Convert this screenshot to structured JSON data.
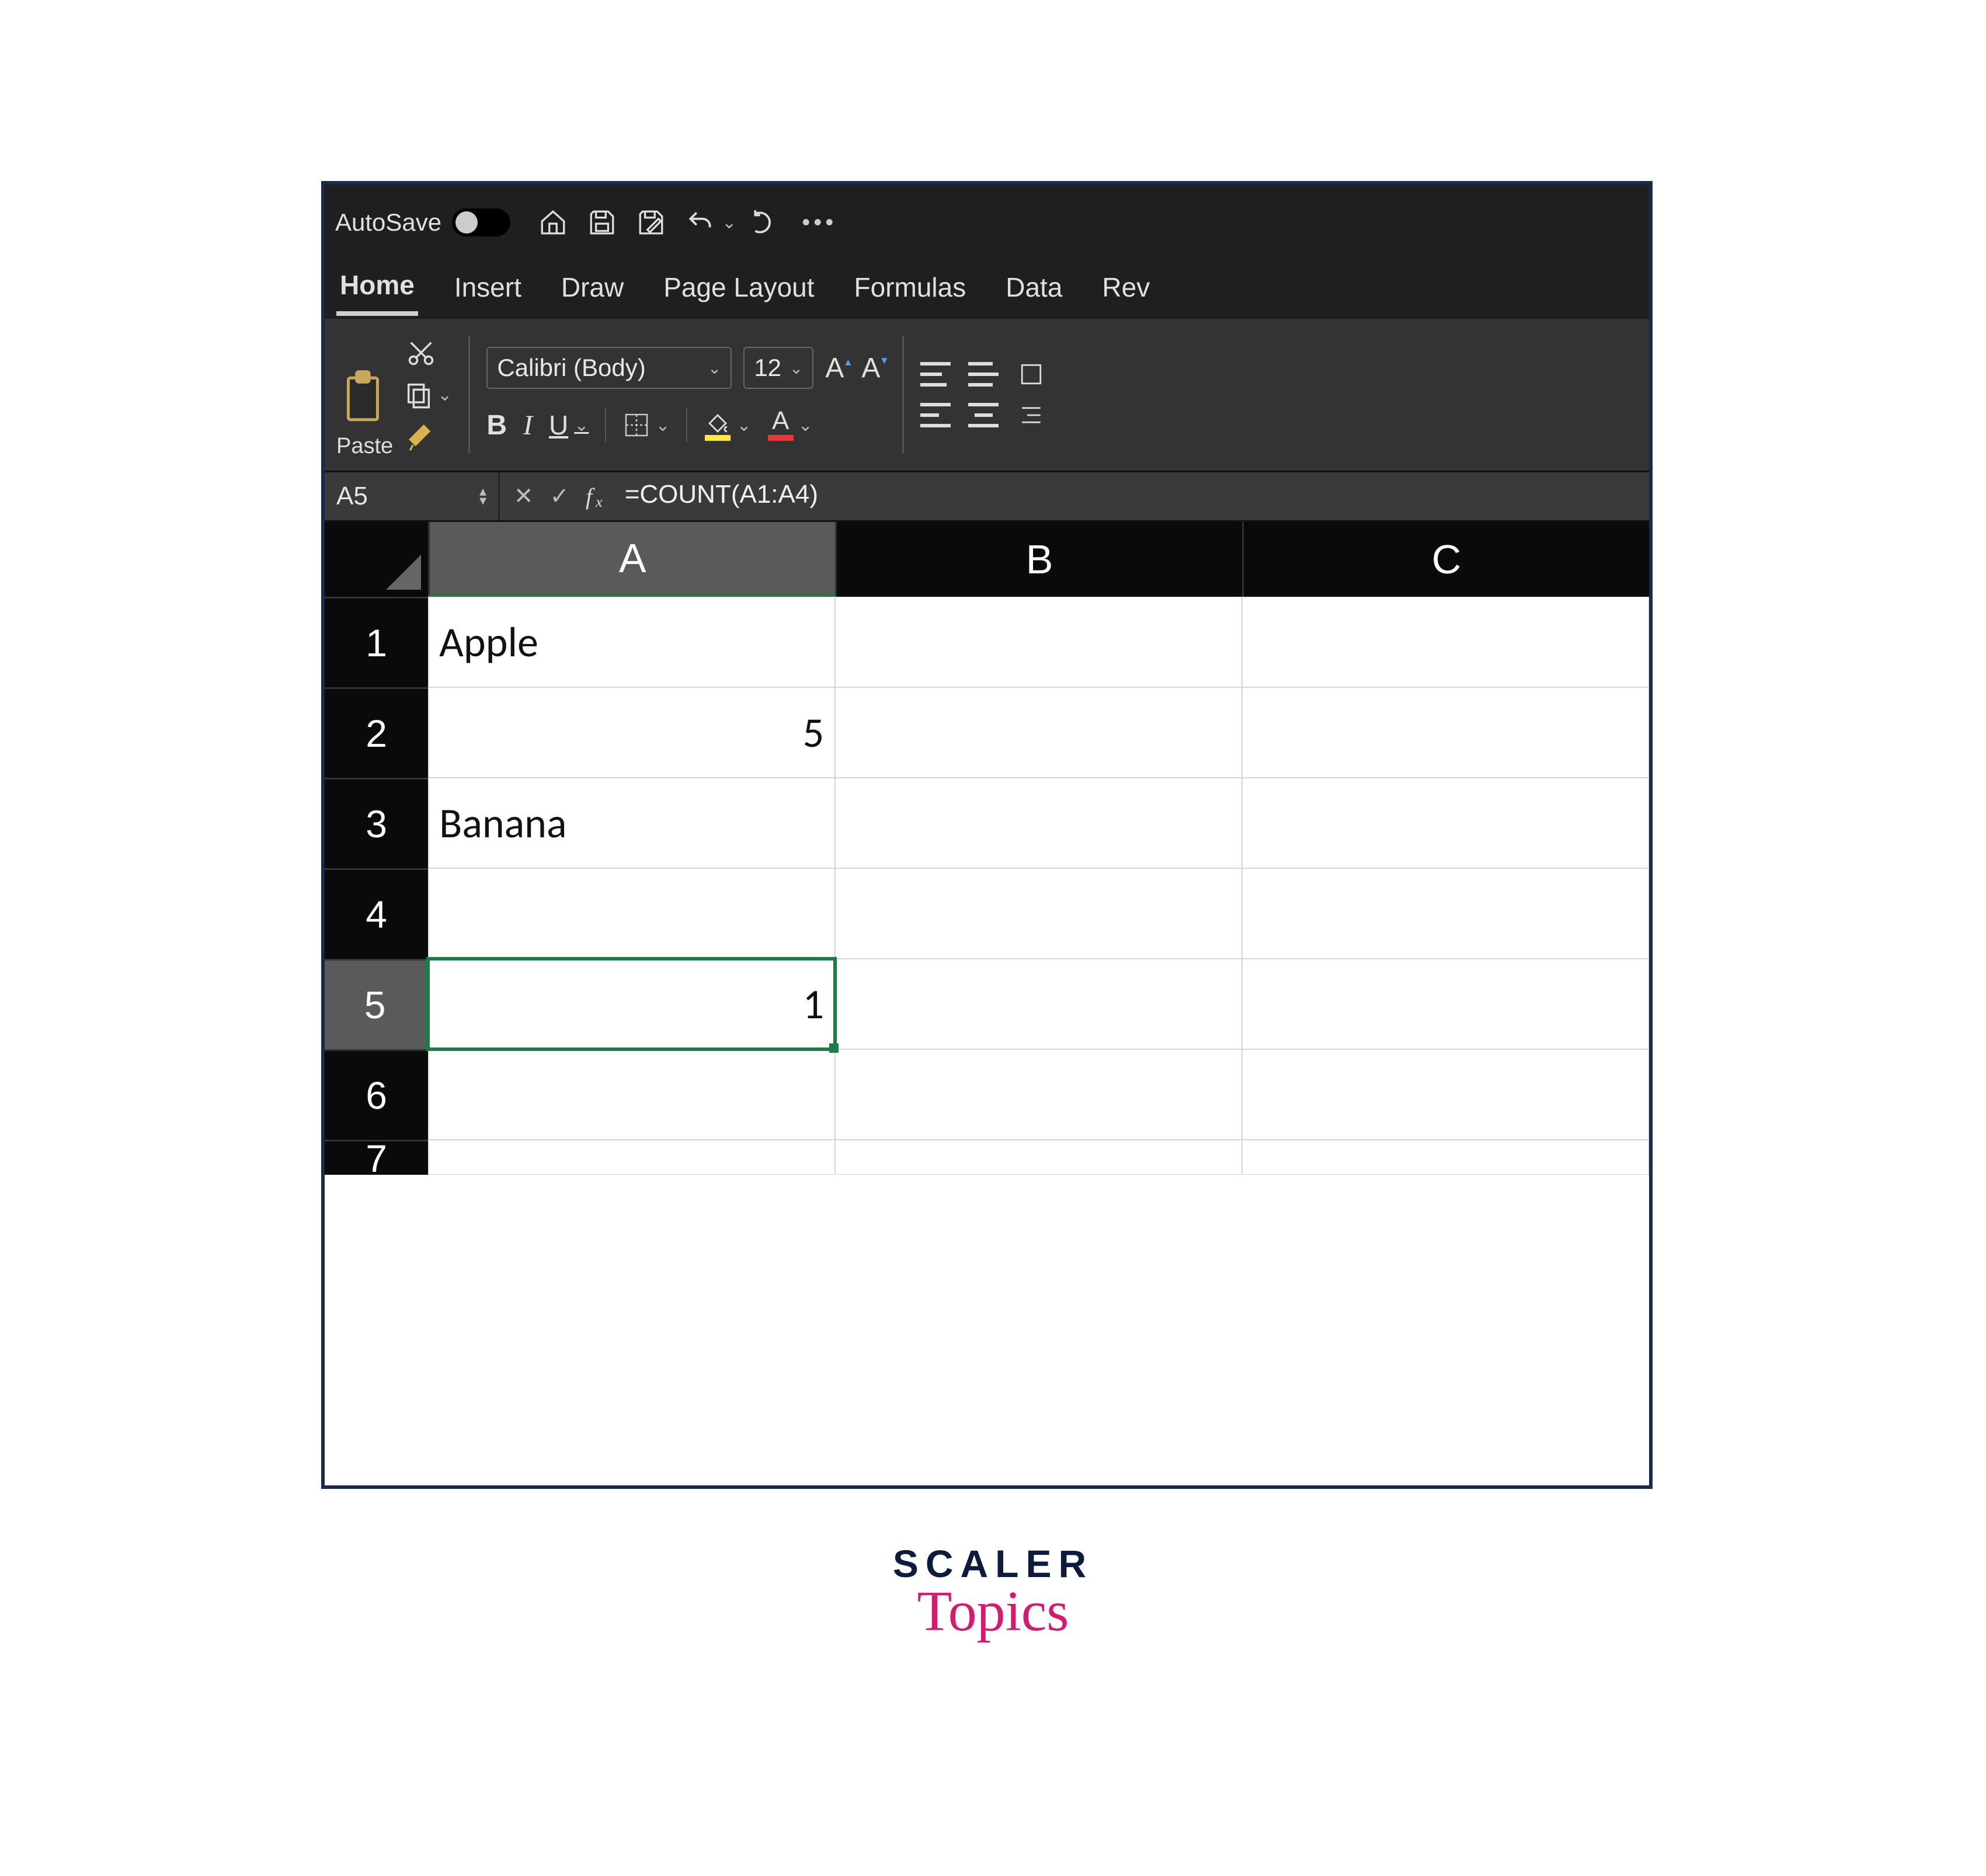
{
  "titlebar": {
    "autosave_label": "AutoSave",
    "autosave_on": false
  },
  "ribbon": {
    "tabs": [
      "Home",
      "Insert",
      "Draw",
      "Page Layout",
      "Formulas",
      "Data",
      "Rev"
    ],
    "active_tab": "Home",
    "paste_label": "Paste",
    "font_name": "Calibri (Body)",
    "font_size": "12"
  },
  "formula_bar": {
    "name_box": "A5",
    "formula": "=COUNT(A1:A4)"
  },
  "sheet": {
    "columns": [
      "A",
      "B",
      "C"
    ],
    "selected_col": "A",
    "selected_row": 5,
    "rows": [
      {
        "n": "1",
        "A": "Apple",
        "A_align": "left",
        "B": "",
        "C": ""
      },
      {
        "n": "2",
        "A": "5",
        "A_align": "right",
        "B": "",
        "C": ""
      },
      {
        "n": "3",
        "A": "Banana",
        "A_align": "left",
        "B": "",
        "C": ""
      },
      {
        "n": "4",
        "A": "",
        "A_align": "left",
        "B": "",
        "C": ""
      },
      {
        "n": "5",
        "A": "1",
        "A_align": "right",
        "B": "",
        "C": ""
      },
      {
        "n": "6",
        "A": "",
        "A_align": "left",
        "B": "",
        "C": ""
      },
      {
        "n": "7",
        "A": "",
        "A_align": "left",
        "B": "",
        "C": ""
      }
    ],
    "selected_cell": "A5"
  },
  "brand": {
    "line1": "SCALER",
    "line2": "Topics"
  }
}
